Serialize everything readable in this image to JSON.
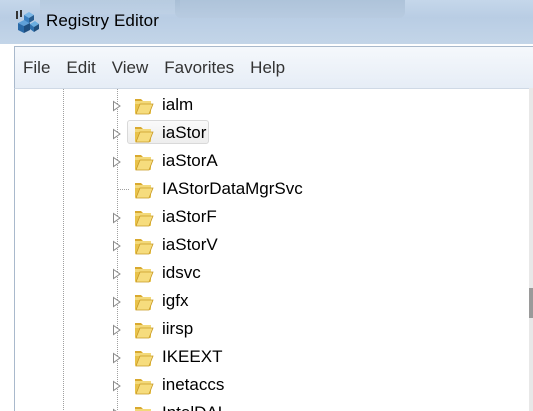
{
  "window": {
    "title": "Registry Editor",
    "icon": "registry-editor-icon"
  },
  "menu": {
    "items": [
      "File",
      "Edit",
      "View",
      "Favorites",
      "Help"
    ]
  },
  "tree": {
    "selected_index": 1,
    "items": [
      {
        "label": "ialm",
        "expandable": true,
        "icon": "folder-icon"
      },
      {
        "label": "iaStor",
        "expandable": true,
        "icon": "folder-icon"
      },
      {
        "label": "iaStorA",
        "expandable": true,
        "icon": "folder-icon"
      },
      {
        "label": "IAStorDataMgrSvc",
        "expandable": false,
        "icon": "folder-icon"
      },
      {
        "label": "iaStorF",
        "expandable": true,
        "icon": "folder-icon"
      },
      {
        "label": "iaStorV",
        "expandable": true,
        "icon": "folder-icon"
      },
      {
        "label": "idsvc",
        "expandable": true,
        "icon": "folder-icon"
      },
      {
        "label": "igfx",
        "expandable": true,
        "icon": "folder-icon"
      },
      {
        "label": "iirsp",
        "expandable": true,
        "icon": "folder-icon"
      },
      {
        "label": "IKEEXT",
        "expandable": true,
        "icon": "folder-icon"
      },
      {
        "label": "inetaccs",
        "expandable": true,
        "icon": "folder-icon"
      },
      {
        "label": "IntelDAL",
        "expandable": true,
        "icon": "folder-icon"
      }
    ]
  },
  "colors": {
    "titlebar": "#c5d7ea",
    "folder": "#e8c24a",
    "selection_border": "#d9d9d9"
  }
}
